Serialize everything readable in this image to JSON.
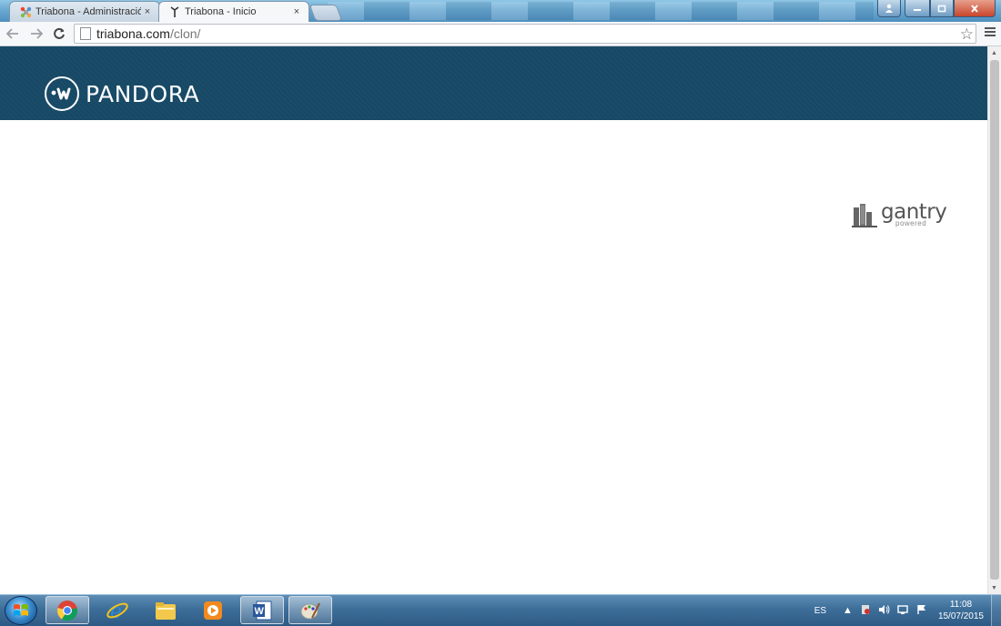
{
  "browser": {
    "tabs": [
      {
        "label": "Triabona - Administración",
        "close": "×",
        "icon": "joomla-icon",
        "active": false
      },
      {
        "label": "Triabona - Inicio",
        "close": "×",
        "icon": "triabona-icon",
        "active": true
      }
    ],
    "url": {
      "host": "triabona.com",
      "path": "/clon/"
    }
  },
  "page": {
    "logo_text": "PANDORA",
    "gantry": {
      "word": "gantry",
      "sub": "powered"
    }
  },
  "taskbar": {
    "apps": [
      "chrome-icon",
      "internet-explorer-icon",
      "file-explorer-icon",
      "media-player-icon",
      "word-icon",
      "paint-icon"
    ],
    "language": "ES",
    "time": "11:08",
    "date": "15/07/2015"
  },
  "colors": {
    "header_bg": "#174966",
    "taskbar": "#3d6e99"
  }
}
